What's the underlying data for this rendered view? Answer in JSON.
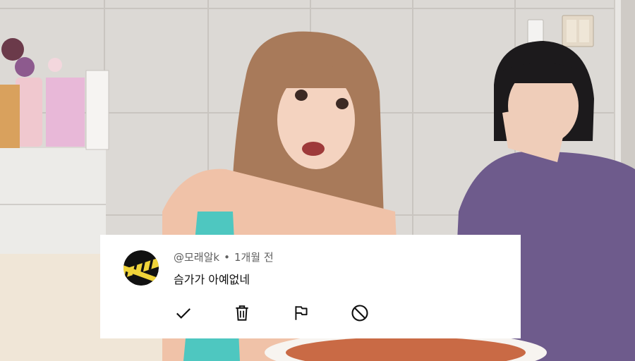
{
  "comment": {
    "author": "@모래알k",
    "separator": "•",
    "time": "1개월 전",
    "text": "슴가가 아예없네"
  },
  "actions": [
    {
      "icon": "check-icon"
    },
    {
      "icon": "trash-icon"
    },
    {
      "icon": "flag-icon"
    },
    {
      "icon": "block-icon"
    }
  ]
}
